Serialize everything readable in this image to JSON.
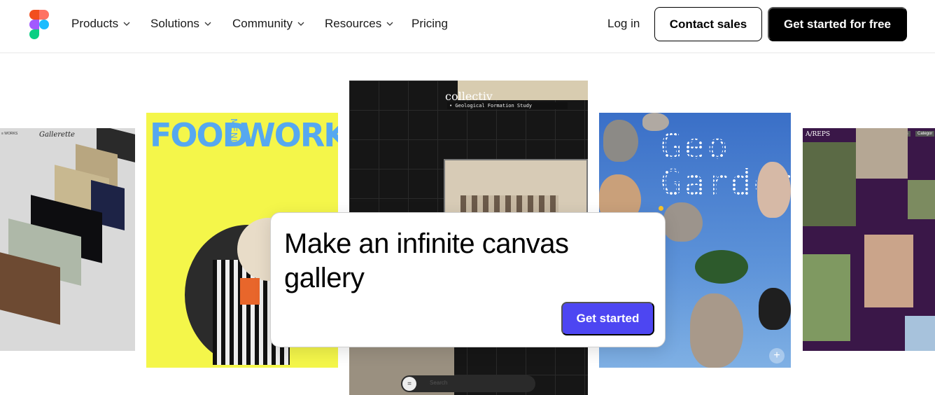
{
  "nav": {
    "items": [
      {
        "label": "Products",
        "has_menu": true
      },
      {
        "label": "Solutions",
        "has_menu": true
      },
      {
        "label": "Community",
        "has_menu": true
      },
      {
        "label": "Resources",
        "has_menu": true
      },
      {
        "label": "Pricing",
        "has_menu": false
      }
    ],
    "login": "Log in",
    "contact_sales": "Contact sales",
    "get_started_free": "Get started for free",
    "logo_icon": "figma-logo-icon"
  },
  "gallery": {
    "card1": {
      "title": "Gallerette"
    },
    "card2": {
      "word1": "FOOD",
      "menu": "MENU",
      "word2": "WORKS"
    },
    "card3": {
      "title": "collectiv",
      "subtitle": "• Geological Formation Study",
      "search_placeholder": "Search"
    },
    "card4": {
      "title_line1": "Geo",
      "title_line2": "Garden"
    },
    "card5": {
      "title": "A/REPS",
      "tab1": "Artists",
      "tab2": "Categor"
    }
  },
  "dialog": {
    "heading": "Make an infinite canvas gallery",
    "cta": "Get started"
  },
  "colors": {
    "accent": "#4d46f2",
    "food_bg": "#f4f64a",
    "food_text": "#56a8f0",
    "reps_bg": "#3a1748"
  }
}
